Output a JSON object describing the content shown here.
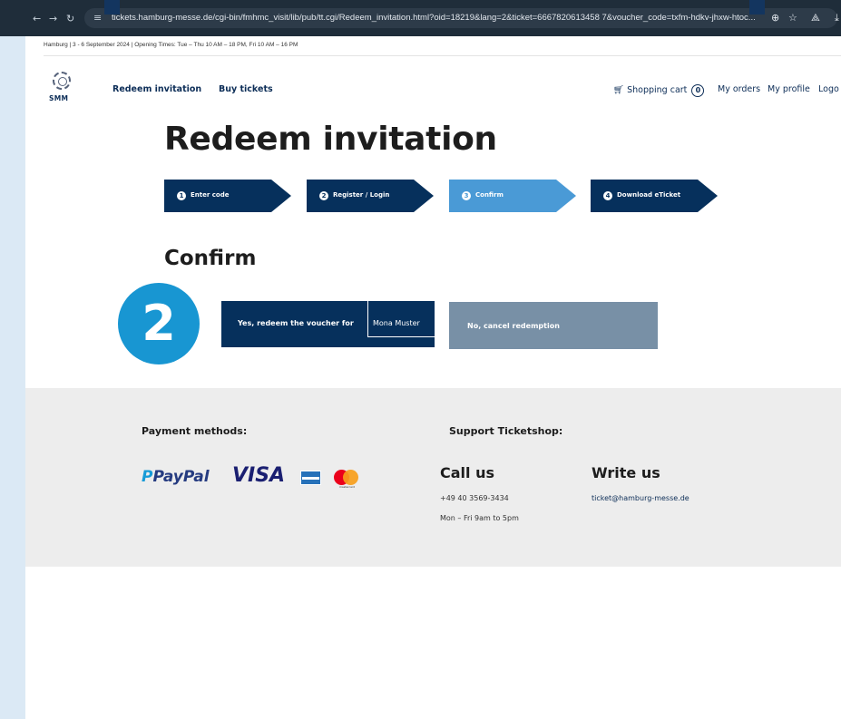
{
  "browser": {
    "url": "tickets.hamburg-messe.de/cgi-bin/fmhmc_visit/lib/pub/tt.cgi/Redeem_invitation.html?oid=18219&lang=2&ticket=6667820613458...",
    "url_full": "tickets.hamburg-messe.de/cgi-bin/fmhmc_visit/lib/pub/tt.cgi/Redeem_invitation.html?oid=18219&lang=2&ticket=6667820613458 7&voucher_code=txfm-hdkv-jhxw-htoc..."
  },
  "info_bar": "Hamburg | 3 - 6 September 2024 | Opening Times: Tue – Thu 10 AM – 18 PM, Fri 10 AM – 16 PM",
  "logo": {
    "text": "SMM"
  },
  "main_nav": {
    "redeem": "Redeem invitation",
    "buy": "Buy tickets"
  },
  "user_nav": {
    "cart": "Shopping cart",
    "cart_count": "0",
    "orders": "My orders",
    "profile": "My profile",
    "logout": "Logo"
  },
  "title": "Redeem invitation",
  "steps": [
    {
      "num": "1",
      "label": "Enter code"
    },
    {
      "num": "2",
      "label": "Register / Login"
    },
    {
      "num": "3",
      "label": "Confirm"
    },
    {
      "num": "4",
      "label": "Download eTicket"
    }
  ],
  "section_title": "Confirm",
  "badge": "2",
  "buttons": {
    "yes_label": "Yes, redeem the voucher for",
    "yes_name": "Mona Muster",
    "no_label": "No, cancel redemption"
  },
  "footer": {
    "payment_heading": "Payment methods:",
    "support_heading": "Support Ticketshop:",
    "call_heading": "Call us",
    "phone": "+49 40 3569-3434",
    "hours": "Mon – Fri 9am to 5pm",
    "write_heading": "Write us",
    "email": "ticket@hamburg-messe.de",
    "paypal_a": "P",
    "paypal_b": "PayPal",
    "visa": "VISA",
    "mastercard": "mastercard"
  },
  "colors": {
    "navy": "#06305c",
    "step_active": "#4a9ad6",
    "badge": "#1896d2",
    "cancel_button": "#7890a6",
    "footer_bg": "#ededed"
  }
}
